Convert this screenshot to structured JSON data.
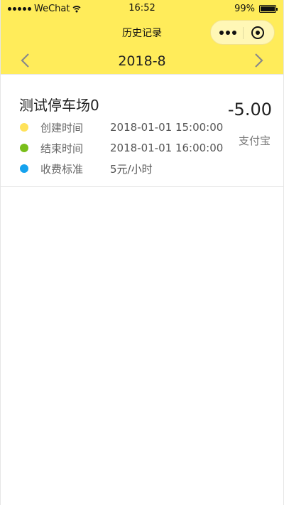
{
  "status_bar": {
    "carrier": "WeChat",
    "time": "16:52",
    "battery_percent": "99%",
    "battery_level": 0.99
  },
  "nav": {
    "title": "历史记录"
  },
  "month_selector": {
    "month": "2018-8"
  },
  "records": [
    {
      "parking_lot": "测试停车场0",
      "amount": "-5.00",
      "payment_method": "支付宝",
      "details": [
        {
          "label": "创建时间",
          "value": "2018-01-01 15:00:00",
          "color": "#ffe25a"
        },
        {
          "label": "结束时间",
          "value": "2018-01-01 16:00:00",
          "color": "#79be1a"
        },
        {
          "label": "收费标准",
          "value": "5元/小时",
          "color": "#15a2ee"
        }
      ]
    }
  ],
  "colors": {
    "header_bg": "#ffec5a"
  },
  "icons": {
    "prev": "chevron-left-icon",
    "next": "chevron-right-icon",
    "more": "more-dots-icon",
    "close": "target-circle-icon",
    "signal": "signal-dots-icon",
    "wifi": "wifi-icon",
    "battery": "battery-icon"
  }
}
